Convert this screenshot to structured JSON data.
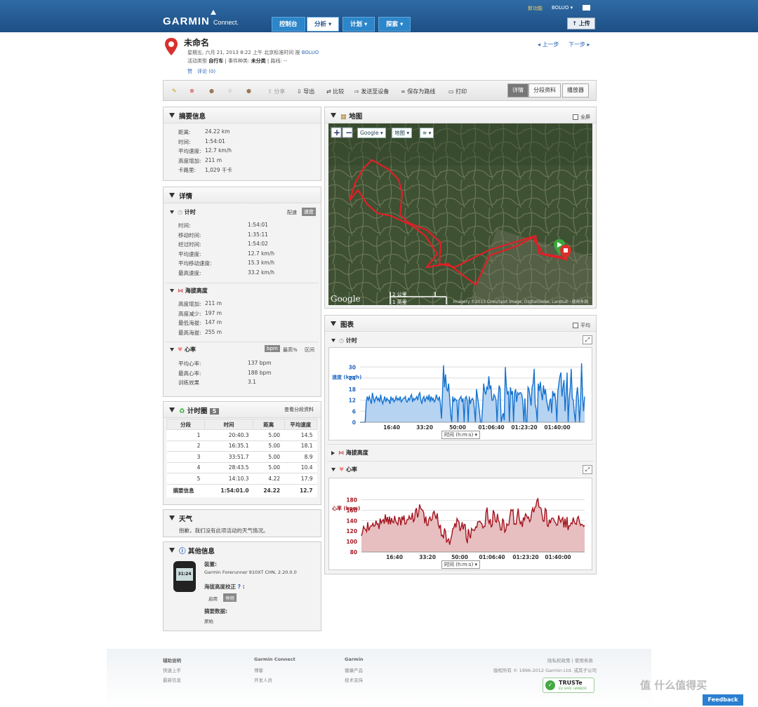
{
  "header": {
    "brand": "GARMIN",
    "brand_sub": "Connect.",
    "nav": [
      "控制台",
      "分析",
      "计划",
      "探索"
    ],
    "new_feature": "新功能",
    "user": "BOLUO",
    "upload": "上传"
  },
  "activity": {
    "title": "未命名",
    "date_line": "星期五, 六月 21, 2013 8:22 上午 北京标准时间 按",
    "owner": "BOLUO",
    "type_label": "活动类型",
    "type_value": "自行车",
    "event_label": "事件种类:",
    "event_value": "未分类",
    "route_label": "路线:",
    "route_value": "--",
    "like": "赞",
    "comments": "评论 (0)",
    "prev": "上一步",
    "next": "下一步"
  },
  "toolbar": {
    "share": "分享",
    "export": "导出",
    "compare": "比较",
    "send": "发送至设备",
    "save_route": "保存为路线",
    "print": "打印",
    "tabs": [
      "详情",
      "分段资料",
      "播放器"
    ]
  },
  "summary": {
    "title": "摘要信息",
    "rows": [
      [
        "距离:",
        "24.22 km"
      ],
      [
        "时间:",
        "1:54:01"
      ],
      [
        "平均速度:",
        "12.7 km/h"
      ],
      [
        "高度增加:",
        "211 m"
      ],
      [
        "卡路里:",
        "1,029 千卡"
      ]
    ]
  },
  "details": {
    "title": "详情",
    "timing": {
      "title": "计时",
      "pace": "配速",
      "speed": "速度",
      "rows": [
        [
          "时间:",
          "1:54:01"
        ],
        [
          "移动时间:",
          "1:35:11"
        ],
        [
          "经过时间:",
          "1:54:02"
        ],
        [
          "平均速度:",
          "12.7 km/h"
        ],
        [
          "平均移动速度:",
          "15.3 km/h"
        ],
        [
          "最高速度:",
          "33.2 km/h"
        ]
      ]
    },
    "elevation": {
      "title": "海拔高度",
      "rows": [
        [
          "高度增加:",
          "211 m"
        ],
        [
          "高度减少:",
          "197 m"
        ],
        [
          "最低海拔:",
          "147 m"
        ],
        [
          "最高海拔:",
          "255 m"
        ]
      ]
    },
    "hr": {
      "title": "心率",
      "bpm": "bpm",
      "max_pct": "最高%",
      "zone": "区间",
      "rows": [
        [
          "平均心率:",
          "137 bpm"
        ],
        [
          "最高心率:",
          "188 bpm"
        ],
        [
          "训练效果",
          "3.1"
        ]
      ]
    }
  },
  "laps": {
    "title": "计时圈",
    "count": "5",
    "link": "查看分段资料",
    "headers": [
      "分段",
      "时间",
      "距离",
      "平均速度"
    ],
    "rows": [
      [
        "1",
        "20:40.3",
        "5.00",
        "14.5"
      ],
      [
        "2",
        "16:35.1",
        "5.00",
        "18.1"
      ],
      [
        "3",
        "33:51.7",
        "5.00",
        "8.9"
      ],
      [
        "4",
        "28:43.5",
        "5.00",
        "10.4"
      ],
      [
        "5",
        "14:10.3",
        "4.22",
        "17.9"
      ]
    ],
    "total": [
      "摘要信息",
      "1:54:01.0",
      "24.22",
      "12.7"
    ]
  },
  "weather": {
    "title": "天气",
    "text": "抱歉，我们没有此项活动的天气情况。"
  },
  "other": {
    "title": "其他信息",
    "device_label": "装置:",
    "device": "Garmin Forerunner 910XT CHN, 2.20.0.0",
    "watch_time": "31:24",
    "elev_label": "海拔高度校正",
    "enable": "启用",
    "disable": "停用",
    "data_label": "摘要数据:",
    "data_value": "原始"
  },
  "map": {
    "title": "地图",
    "fullscreen": "全屏",
    "provider": "Google",
    "type": "地图",
    "scale_km": "2 公里",
    "scale_mi": "1 英里",
    "credit": "Imagery ©2013 Cnes/Spot Image, DigitalGlobe, Landsat · 使用条款",
    "google": "Google"
  },
  "charts": {
    "title": "图表",
    "avg": "平均",
    "timing": "计时",
    "elevation": "海拔高度",
    "hr": "心率",
    "xsel": "时间 (h:m:s)"
  },
  "chart_data": [
    {
      "type": "area",
      "ylabel": "速度 (km/h)",
      "ylim": [
        0,
        32
      ],
      "yticks": [
        "30",
        "24",
        "18",
        "12",
        "6",
        "0"
      ],
      "xticks": [
        "16:40",
        "33:20",
        "50:00",
        "01:06:40",
        "01:23:20",
        "01:40:00"
      ],
      "xlabel": "时间 (h:m:s)",
      "values": [
        0,
        0,
        0,
        0,
        0,
        0,
        11,
        14,
        12,
        14,
        12,
        10,
        16,
        13,
        11,
        13,
        14,
        12,
        13,
        11,
        15,
        12,
        10,
        12,
        14,
        11,
        13,
        12,
        12,
        10,
        14,
        12,
        13,
        11,
        12,
        14,
        12,
        13,
        12,
        14,
        11,
        12,
        13,
        13,
        14,
        11,
        11,
        13,
        12,
        14,
        15,
        11,
        13,
        12,
        13,
        14,
        12,
        15,
        16,
        12,
        10,
        13,
        14,
        11,
        13,
        14,
        12,
        15,
        11,
        14,
        12,
        13,
        11,
        12,
        15,
        13,
        12,
        14,
        10,
        2,
        15,
        31,
        19,
        26,
        18,
        17,
        21,
        13,
        4,
        0,
        14,
        11,
        13,
        12,
        12,
        0,
        12,
        13,
        14,
        11,
        13,
        0,
        13,
        14,
        12,
        0,
        14,
        10,
        12,
        13,
        12,
        7,
        0,
        18,
        14,
        10,
        5,
        0,
        0,
        9,
        21,
        17,
        15,
        19,
        18,
        25,
        18,
        20,
        12,
        12,
        15,
        14,
        12,
        0,
        13,
        20,
        18,
        0,
        3,
        5,
        1,
        30,
        20,
        15,
        17,
        0,
        19,
        15,
        17,
        0,
        16,
        18,
        11,
        16,
        15,
        16,
        16,
        15,
        11,
        0,
        13,
        0,
        0,
        19,
        18,
        14,
        9,
        19,
        21,
        29,
        10,
        7,
        0,
        21,
        17,
        22,
        16,
        12,
        20,
        15,
        18,
        12,
        9,
        6,
        11,
        13,
        5,
        17,
        14,
        16,
        11,
        0,
        17,
        21,
        25,
        27,
        14,
        19,
        23,
        6,
        16,
        27,
        0,
        13,
        18,
        29,
        13,
        12,
        5,
        0,
        14,
        19,
        12,
        0,
        10,
        32,
        14,
        6,
        14
      ]
    },
    {
      "type": "area",
      "ylabel": "心率 (bpm)",
      "ylim": [
        80,
        190
      ],
      "yticks": [
        "180",
        "160",
        "140",
        "120",
        "100",
        "80"
      ],
      "xticks": [
        "16:40",
        "33:20",
        "50:00",
        "01:06:40",
        "01:23:20",
        "01:40:00"
      ],
      "xlabel": "时间 (h:m:s)",
      "values": [
        111,
        118,
        129,
        125,
        123,
        119,
        137,
        121,
        126,
        130,
        130,
        135,
        129,
        130,
        140,
        133,
        134,
        124,
        144,
        135,
        140,
        142,
        134,
        152,
        137,
        147,
        133,
        148,
        133,
        145,
        137,
        136,
        149,
        139,
        135,
        132,
        146,
        145,
        131,
        148,
        141,
        150,
        133,
        134,
        142,
        142,
        149,
        143,
        143,
        155,
        138,
        141,
        159,
        164,
        146,
        153,
        171,
        164,
        161,
        160,
        155,
        135,
        148,
        131,
        131,
        143,
        147,
        140,
        142,
        155,
        158,
        150,
        143,
        154,
        132,
        126,
        132,
        111,
        112,
        106,
        125,
        119,
        98,
        103,
        105,
        94,
        104,
        112,
        125,
        126,
        135,
        127,
        144,
        140,
        137,
        120,
        126,
        137,
        123,
        133,
        132,
        105,
        97,
        124,
        113,
        106,
        125,
        122,
        122,
        121,
        128,
        127,
        138,
        138,
        139,
        136,
        134,
        126,
        129,
        129,
        156,
        165,
        142,
        135,
        143,
        128,
        131,
        160,
        154,
        139,
        137,
        153,
        140,
        136,
        122,
        122,
        144,
        139,
        118,
        121,
        134,
        131,
        132,
        149,
        161,
        159,
        161,
        133,
        134,
        133,
        150,
        163,
        144,
        134,
        138,
        128,
        146,
        141,
        153,
        150,
        145,
        147,
        138,
        141,
        157,
        164,
        156,
        165,
        167,
        179,
        182,
        166,
        165,
        164,
        150,
        139,
        139,
        163,
        160,
        130,
        129,
        142,
        135,
        144,
        145,
        144,
        138,
        136,
        131,
        132,
        150,
        142,
        137,
        143,
        146,
        127,
        144,
        127,
        147,
        122,
        130,
        130,
        136,
        134,
        146,
        138,
        134,
        133,
        145,
        148,
        138,
        131,
        133,
        132,
        129,
        131
      ]
    }
  ],
  "footer": {
    "help": "辅助说明",
    "quick": "快速上手",
    "latest": "最新信息",
    "gc": "Garmin Connect",
    "blog": "博客",
    "dev": "开发人员",
    "garmin": "Garmin",
    "products": "健康产品",
    "support": "技术支持",
    "legal": "隐私权政策 | 使用条款",
    "copyright": "版权所有 © 1996-2012 Garmin Ltd. 或其子公司",
    "truste": "TRUSTe",
    "truste_sub": "EU SAFE HARBOR",
    "watermark": "值 什么值得买",
    "feedback": "Feedback"
  }
}
